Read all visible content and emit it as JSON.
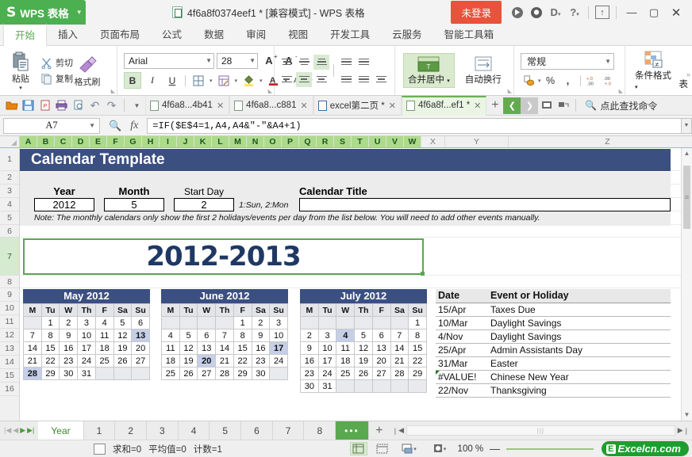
{
  "titlebar": {
    "app_name": "WPS 表格",
    "doc_title": "4f6a8f0374eef1 * [兼容模式] - WPS 表格",
    "login_label": "未登录",
    "buttons": [
      "minimize",
      "maximize",
      "close"
    ]
  },
  "ribbon_tabs": [
    {
      "label": "开始",
      "active": true
    },
    {
      "label": "插入",
      "active": false
    },
    {
      "label": "页面布局",
      "active": false
    },
    {
      "label": "公式",
      "active": false
    },
    {
      "label": "数据",
      "active": false
    },
    {
      "label": "审阅",
      "active": false
    },
    {
      "label": "视图",
      "active": false
    },
    {
      "label": "开发工具",
      "active": false
    },
    {
      "label": "云服务",
      "active": false
    },
    {
      "label": "智能工具箱",
      "active": false
    }
  ],
  "ribbon": {
    "paste_label": "粘贴",
    "cut_label": "剪切",
    "copy_label": "复制",
    "format_painter_label": "格式刷",
    "font_name": "Arial",
    "font_size": "28",
    "merge_label": "合并居中",
    "wrap_label": "自动换行",
    "number_format": "常规",
    "cond_format_label": "条件格式",
    "table_label": "表"
  },
  "doctabs": {
    "tabs": [
      {
        "label": "4f6a8...4b41",
        "active": false,
        "dirty": false
      },
      {
        "label": "4f6a8...c881",
        "active": false,
        "dirty": false
      },
      {
        "label": "excel第二页 *",
        "active": false,
        "dirty": true
      },
      {
        "label": "4f6a8f...ef1 *",
        "active": true,
        "dirty": true
      }
    ],
    "add_label": "+",
    "find_placeholder": "点此查找命令"
  },
  "formula_bar": {
    "name_box": "A7",
    "formula": "=IF($E$4=1,A4,A4&\"-\"&A4+1)"
  },
  "grid": {
    "columns": [
      "A",
      "B",
      "C",
      "D",
      "E",
      "F",
      "G",
      "H",
      "I",
      "J",
      "K",
      "L",
      "M",
      "N",
      "O",
      "P",
      "Q",
      "R",
      "S",
      "T",
      "U",
      "V",
      "W",
      "X",
      "Y",
      "Z"
    ],
    "selected_columns": [
      "A",
      "B",
      "C",
      "D",
      "E",
      "F",
      "G",
      "H",
      "I",
      "J",
      "K",
      "L",
      "M",
      "N",
      "O",
      "P",
      "Q",
      "R",
      "S",
      "T",
      "U",
      "V",
      "W"
    ],
    "rows": [
      "1",
      "2",
      "3",
      "4",
      "5",
      "6",
      "7",
      "8",
      "9",
      "10",
      "11",
      "12",
      "13",
      "14",
      "15",
      "16"
    ],
    "selected_row": "7"
  },
  "sheet": {
    "banner_title": "Calendar Template",
    "year_label": "Year",
    "month_label": "Month",
    "startday_label": "Start Day",
    "calendar_title_label": "Calendar Title",
    "year_value": "2012",
    "month_value": "5",
    "startday_value": "2",
    "startday_hint": "1:Sun, 2:Mon",
    "calendar_title_value": "",
    "note": "Note: The monthly calendars only show the first 2 holidays/events per day from the list below.  You will need to add other events manually.",
    "big_year": "2012-2013"
  },
  "calendars": [
    {
      "title": "May 2012",
      "dow": [
        "M",
        "Tu",
        "W",
        "Th",
        "F",
        "Sa",
        "Su"
      ],
      "weeks": [
        [
          "",
          "1",
          "2",
          "3",
          "4",
          "5",
          "6"
        ],
        [
          "7",
          "8",
          "9",
          "10",
          "11",
          "12",
          "13"
        ],
        [
          "14",
          "15",
          "16",
          "17",
          "18",
          "19",
          "20"
        ],
        [
          "21",
          "22",
          "23",
          "24",
          "25",
          "26",
          "27"
        ],
        [
          "28",
          "29",
          "30",
          "31",
          "",
          "",
          ""
        ]
      ],
      "highlighted": [
        "13",
        "28"
      ]
    },
    {
      "title": "June 2012",
      "dow": [
        "M",
        "Tu",
        "W",
        "Th",
        "F",
        "Sa",
        "Su"
      ],
      "weeks": [
        [
          "",
          "",
          "",
          "",
          "1",
          "2",
          "3"
        ],
        [
          "4",
          "5",
          "6",
          "7",
          "8",
          "9",
          "10"
        ],
        [
          "11",
          "12",
          "13",
          "14",
          "15",
          "16",
          "17"
        ],
        [
          "18",
          "19",
          "20",
          "21",
          "22",
          "23",
          "24"
        ],
        [
          "25",
          "26",
          "27",
          "28",
          "29",
          "30",
          ""
        ]
      ],
      "highlighted": [
        "17",
        "20"
      ]
    },
    {
      "title": "July 2012",
      "dow": [
        "M",
        "Tu",
        "W",
        "Th",
        "F",
        "Sa",
        "Su"
      ],
      "weeks": [
        [
          "",
          "",
          "",
          "",
          "",
          "",
          "1"
        ],
        [
          "2",
          "3",
          "4",
          "5",
          "6",
          "7",
          "8"
        ],
        [
          "9",
          "10",
          "11",
          "12",
          "13",
          "14",
          "15"
        ],
        [
          "16",
          "17",
          "18",
          "19",
          "20",
          "21",
          "22"
        ],
        [
          "23",
          "24",
          "25",
          "26",
          "27",
          "28",
          "29"
        ],
        [
          "30",
          "31",
          "",
          "",
          "",
          "",
          ""
        ]
      ],
      "highlighted": [
        "4"
      ]
    }
  ],
  "events": {
    "headers": [
      "Date",
      "Event or Holiday"
    ],
    "rows": [
      {
        "date": "15/Apr",
        "event": "Taxes Due",
        "error": false
      },
      {
        "date": "10/Mar",
        "event": "Daylight Savings",
        "error": false
      },
      {
        "date": "4/Nov",
        "event": "Daylight Savings",
        "error": false
      },
      {
        "date": "25/Apr",
        "event": "Admin Assistants Day",
        "error": false
      },
      {
        "date": "31/Mar",
        "event": "Easter",
        "error": false
      },
      {
        "date": "#VALUE!",
        "event": "Chinese New Year",
        "error": true
      },
      {
        "date": "22/Nov",
        "event": "Thanksgiving",
        "error": false
      }
    ]
  },
  "sheet_tabs": {
    "tabs": [
      {
        "label": "Year",
        "active": true
      },
      {
        "label": "1",
        "active": false
      },
      {
        "label": "2",
        "active": false
      },
      {
        "label": "3",
        "active": false
      },
      {
        "label": "4",
        "active": false
      },
      {
        "label": "5",
        "active": false
      },
      {
        "label": "6",
        "active": false
      },
      {
        "label": "7",
        "active": false
      },
      {
        "label": "8",
        "active": false
      }
    ],
    "more_label": "•••",
    "add_label": "+"
  },
  "statusbar": {
    "sum_label": "求和=0",
    "average_label": "平均值=0",
    "count_label": "计数=1",
    "zoom_level": "100 %",
    "watermark": "Excelcn.com",
    "watermark_badge": "E"
  },
  "colors": {
    "brand_green": "#4caf50",
    "banner_blue": "#3b4f81",
    "alert_red": "#e8533c",
    "selection_green": "#5aa84f",
    "highlight_blue": "#c5cfe8"
  }
}
